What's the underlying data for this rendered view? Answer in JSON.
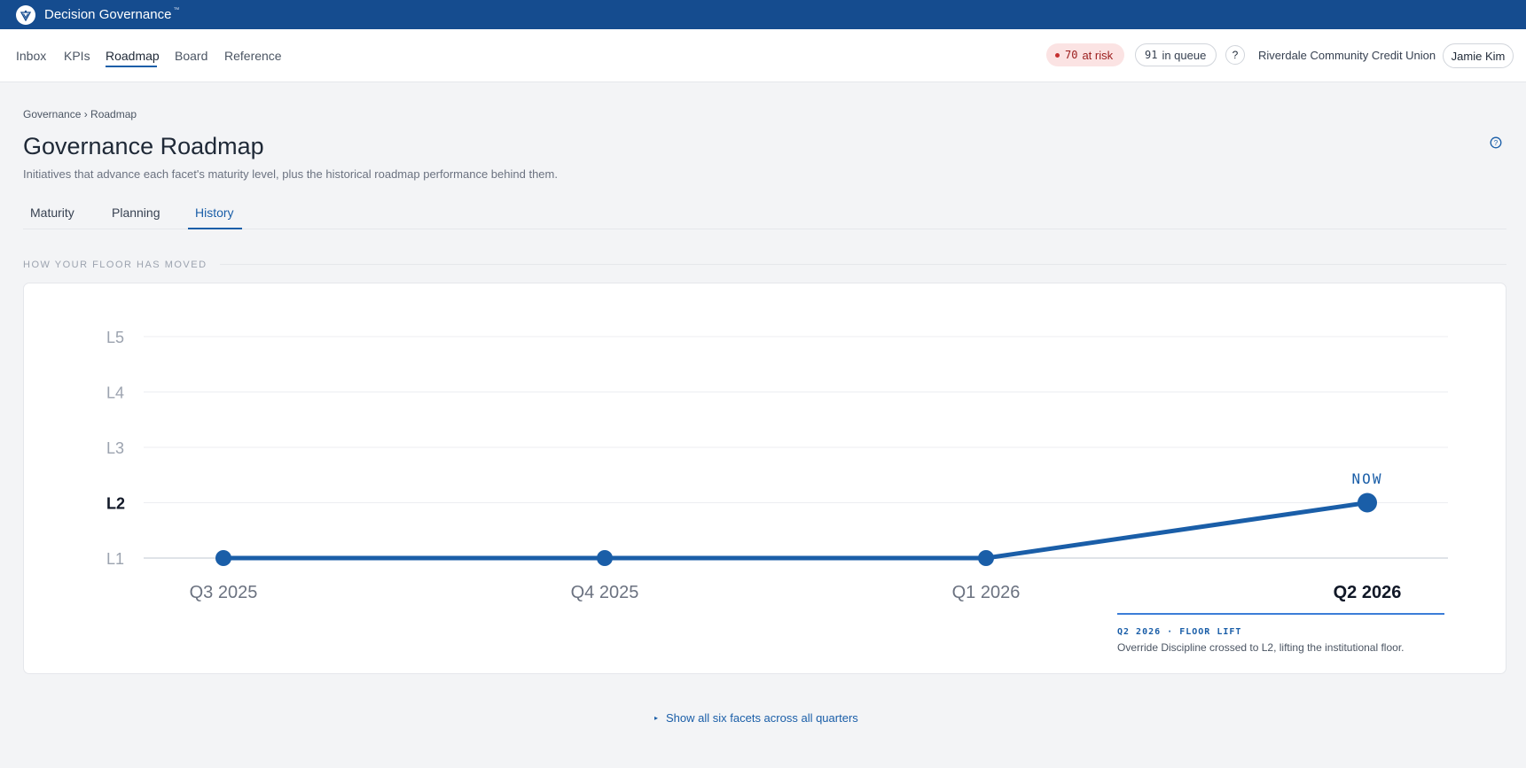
{
  "app": {
    "title": "Decision Governance",
    "trademark": "™"
  },
  "nav": {
    "items": [
      {
        "label": "Inbox",
        "active": false
      },
      {
        "label": "KPIs",
        "active": false
      },
      {
        "label": "Roadmap",
        "active": true
      },
      {
        "label": "Board",
        "active": false
      },
      {
        "label": "Reference",
        "active": false
      }
    ]
  },
  "status": {
    "at_risk_count": "70",
    "at_risk_label": "at risk",
    "queue_count": "91",
    "queue_label": "in queue",
    "help_label": "?",
    "org_name": "Riverdale Community Credit Union",
    "user_name": "Jamie Kim"
  },
  "page": {
    "breadcrumb": "Governance › Roadmap",
    "title": "Governance Roadmap",
    "subtitle": "Initiatives that advance each facet's maturity level, plus the historical roadmap performance behind them."
  },
  "tabs": [
    {
      "label": "Maturity",
      "active": false
    },
    {
      "label": "Planning",
      "active": false
    },
    {
      "label": "History",
      "active": true
    }
  ],
  "section": {
    "label": "HOW YOUR FLOOR HAS MOVED"
  },
  "chart_data": {
    "type": "line",
    "categories": [
      "Q3 2025",
      "Q4 2025",
      "Q1 2026",
      "Q2 2026"
    ],
    "y_levels": [
      "L1",
      "L2",
      "L3",
      "L4",
      "L5"
    ],
    "series": [
      {
        "values": [
          1,
          1,
          1,
          2
        ]
      }
    ],
    "ylim": [
      1,
      5
    ],
    "current_label": "NOW",
    "current_index": 3,
    "grid": true,
    "line_color": "#1a5ea8"
  },
  "callout": {
    "tag": "Q2 2026 · FLOOR LIFT",
    "text": "Override Discipline crossed to L2, lifting the institutional floor."
  },
  "footer": {
    "show_all_label": "Show all six facets across all quarters"
  },
  "colors": {
    "topbar": "#154c8f",
    "accent": "#1a5ea8",
    "risk": "#c53030"
  }
}
